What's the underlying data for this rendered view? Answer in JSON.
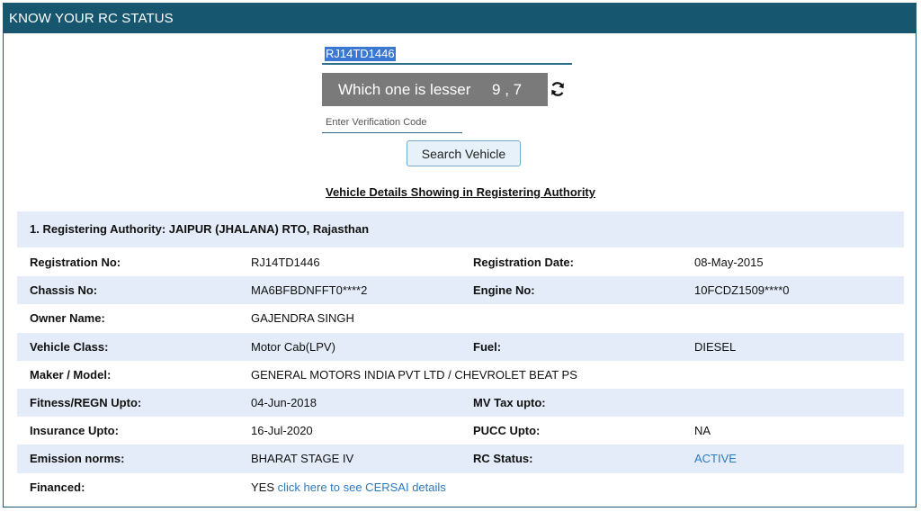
{
  "window": {
    "title": "KNOW YOUR RC STATUS"
  },
  "form": {
    "registration_value": "RJ14TD1446",
    "captcha_question": "Which one is lesser",
    "captcha_numbers": "9 , 7",
    "verification_placeholder": "Enter Verification Code",
    "search_label": "Search Vehicle",
    "refresh_icon": "refresh-icon"
  },
  "section_heading": "Vehicle Details Showing in Registering Authority",
  "authority": "1. Registering Authority: JAIPUR (JHALANA) RTO, Rajasthan",
  "details": {
    "registration_no_label": "Registration No:",
    "registration_no": "RJ14TD1446",
    "registration_date_label": "Registration Date:",
    "registration_date": "08-May-2015",
    "chassis_no_label": "Chassis No:",
    "chassis_no": "MA6BFBDNFFT0****2",
    "engine_no_label": "Engine No:",
    "engine_no": "10FCDZ1509****0",
    "owner_name_label": "Owner Name:",
    "owner_name": "GAJENDRA SINGH",
    "vehicle_class_label": "Vehicle Class:",
    "vehicle_class": "Motor Cab(LPV)",
    "fuel_label": "Fuel:",
    "fuel": "DIESEL",
    "maker_model_label": "Maker / Model:",
    "maker_model": "GENERAL MOTORS INDIA PVT LTD / CHEVROLET BEAT PS",
    "fitness_label": "Fitness/REGN Upto:",
    "fitness": "04-Jun-2018",
    "mv_tax_label": "MV Tax upto:",
    "insurance_label": "Insurance Upto:",
    "insurance": "16-Jul-2020",
    "pucc_label": "PUCC Upto:",
    "pucc": "NA",
    "emission_label": "Emission norms:",
    "emission": "BHARAT STAGE IV",
    "rc_status_label": "RC Status:",
    "rc_status": "ACTIVE",
    "financed_label": "Financed:",
    "financed": "YES",
    "cersai_link": "click here to see CERSAI details"
  },
  "colors": {
    "titlebar": "#16566f",
    "row_shade": "#e3ecf8",
    "link": "#2a7ac0"
  }
}
